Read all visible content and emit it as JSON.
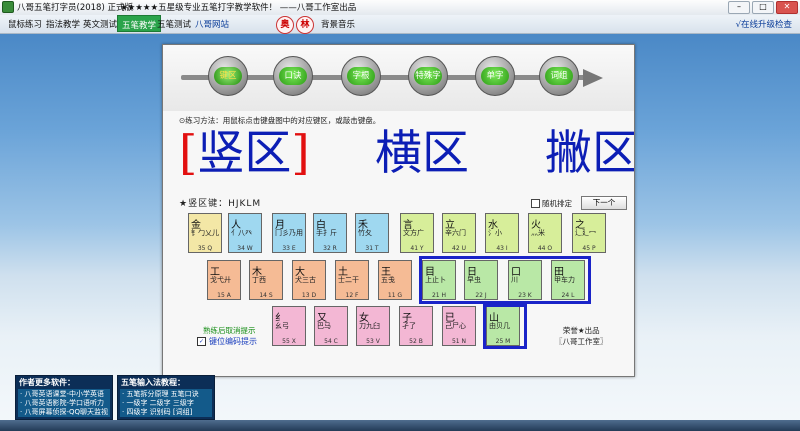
{
  "titlebar": {
    "app_name": "八哥五笔打字员(2018) 正式版",
    "slogan": "★★★★★五星级专业五笔打字教学软件！ ——八哥工作室出品",
    "min": "–",
    "max": "□",
    "close": "✕"
  },
  "menu": {
    "items": [
      "鼠标练习",
      "指法教学",
      "英文测试",
      "五笔教学",
      "五笔测试",
      "八哥网站"
    ],
    "active_index": 3,
    "pills": [
      "奥",
      "林"
    ],
    "music": "背景音乐",
    "upgrade": "√在线升级检查"
  },
  "nav": {
    "stages": [
      "键区",
      "口诀",
      "字根",
      "特殊字",
      "单字",
      "词组"
    ],
    "active_index": 0
  },
  "method": "⊙练习方法：用鼠标点击键盘图中的对应键区，或敲击键盘。",
  "zones": {
    "bracket_open": "[",
    "selected": "竖区",
    "bracket_close": "]",
    "next1": "横区",
    "next2": "撇区"
  },
  "zone_keys": "★竖区键：HJKLM",
  "random_label": "随机排定",
  "next_button": "下一个",
  "keys": {
    "row1": [
      {
        "ch": "金",
        "roots": "钅勹乂儿",
        "code": "35 Q"
      },
      {
        "ch": "人",
        "roots": "亻八癶",
        "code": "34 W"
      },
      {
        "ch": "月",
        "roots": "冂彡乃用",
        "code": "33 E"
      },
      {
        "ch": "白",
        "roots": "手扌斤",
        "code": "32 R"
      },
      {
        "ch": "禾",
        "roots": "竹夂",
        "code": "31 T"
      },
      {
        "ch": "言",
        "roots": "文方广",
        "code": "41 Y"
      },
      {
        "ch": "立",
        "roots": "辛六门",
        "code": "42 U"
      },
      {
        "ch": "水",
        "roots": "氵小",
        "code": "43 I"
      },
      {
        "ch": "火",
        "roots": "灬米",
        "code": "44 O"
      },
      {
        "ch": "之",
        "roots": "辶廴冖",
        "code": "45 P"
      }
    ],
    "row2": [
      {
        "ch": "工",
        "roots": "戈弋廾",
        "code": "15 A"
      },
      {
        "ch": "木",
        "roots": "丁西",
        "code": "14 S"
      },
      {
        "ch": "大",
        "roots": "犬三古",
        "code": "13 D"
      },
      {
        "ch": "土",
        "roots": "士二干",
        "code": "12 F"
      },
      {
        "ch": "王",
        "roots": "五戋",
        "code": "11 G"
      },
      {
        "ch": "目",
        "roots": "上止卜",
        "code": "21 H"
      },
      {
        "ch": "日",
        "roots": "早虫",
        "code": "22 J"
      },
      {
        "ch": "口",
        "roots": "川",
        "code": "23 K"
      },
      {
        "ch": "田",
        "roots": "甲车力",
        "code": "24 L"
      }
    ],
    "row3": [
      {
        "ch": "纟",
        "roots": "幺弓",
        "code": "55 X"
      },
      {
        "ch": "又",
        "roots": "巴马",
        "code": "54 C"
      },
      {
        "ch": "女",
        "roots": "刀九臼",
        "code": "53 V"
      },
      {
        "ch": "子",
        "roots": "孑了",
        "code": "52 B"
      },
      {
        "ch": "已",
        "roots": "己尸心",
        "code": "51 N"
      },
      {
        "ch": "山",
        "roots": "由贝几",
        "code": "25 M"
      }
    ]
  },
  "hint_top": "熟练后取消提示",
  "hint_check": "键位编码提示",
  "maker": {
    "line1": "荣誉★出品",
    "line2": "〖八哥工作室〗"
  },
  "more_software": {
    "title": "作者更多软件：",
    "lines": [
      "· 八哥英语课堂-中小学英语",
      "· 八哥英语影院-学口语听力",
      "· 八哥屏幕侦探-QQ聊天监视"
    ]
  },
  "wubi_course": {
    "title": "五笔输入法教程：",
    "lines": [
      "· 五笔拆分原理  五笔口诀",
      "· 一级字  二级字  三级字",
      "· 四级字  识别码  [词组]"
    ]
  },
  "colors": {
    "accent_green": "#2aa34a",
    "selection_blue": "#1a24c8",
    "bracket_red": "#e21010",
    "zone_text_blue": "#0c1eb5"
  }
}
